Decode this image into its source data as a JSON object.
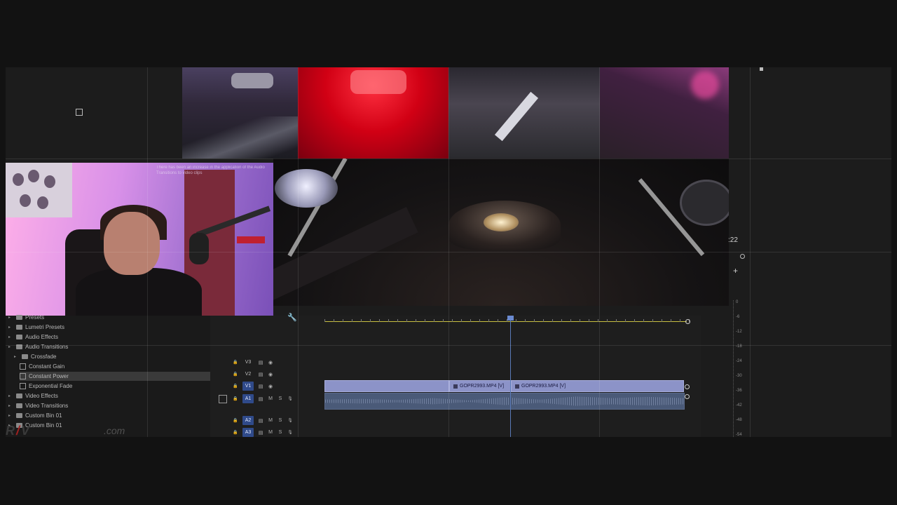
{
  "project_panel": {
    "items": [
      {
        "label": "Presets",
        "indent": 1,
        "type": "folder"
      },
      {
        "label": "Lumetri Presets",
        "indent": 1,
        "type": "folder"
      },
      {
        "label": "Audio Effects",
        "indent": 1,
        "type": "folder"
      },
      {
        "label": "Audio Transitions",
        "indent": 1,
        "type": "folder"
      },
      {
        "label": "Crossfade",
        "indent": 2,
        "type": "folder"
      },
      {
        "label": "Constant Gain",
        "indent": 3,
        "type": "effect"
      },
      {
        "label": "Constant Power",
        "indent": 3,
        "type": "effect",
        "selected": true
      },
      {
        "label": "Exponential Fade",
        "indent": 3,
        "type": "effect"
      },
      {
        "label": "Video Effects",
        "indent": 1,
        "type": "folder"
      },
      {
        "label": "Video Transitions",
        "indent": 1,
        "type": "folder"
      },
      {
        "label": "Custom Bin 01",
        "indent": 1,
        "type": "folder"
      },
      {
        "label": "Custom Bin 01",
        "indent": 1,
        "type": "folder"
      }
    ]
  },
  "watermark": {
    "suffix": ".com"
  },
  "webcam_overlay_text": "There has been an increase in the application of the Audio Transitions to video clips",
  "timeline": {
    "tracks": [
      {
        "name": "V3",
        "kind": "video",
        "active": false
      },
      {
        "name": "V2",
        "kind": "video",
        "active": false
      },
      {
        "name": "V1",
        "kind": "video",
        "active": true
      },
      {
        "name": "A1",
        "kind": "audio",
        "active": true
      },
      {
        "name": "A2",
        "kind": "audio",
        "active": true
      },
      {
        "name": "A3",
        "kind": "audio",
        "active": true
      }
    ],
    "clips": [
      {
        "label": "GOPR2993.MP4 [V]"
      },
      {
        "label": "GOPR2993.MP4 [V]"
      }
    ],
    "mute_label": "M",
    "solo_label": "S"
  },
  "program": {
    "timecode": ":22"
  },
  "meter": {
    "labels": [
      "0",
      "-6",
      "-12",
      "-18",
      "-24",
      "-30",
      "-36",
      "-42",
      "-48",
      "-54"
    ]
  },
  "colors": {
    "accent": "#2f4a8a",
    "clip_video": "#8c93c8",
    "clip_audio": "#4a5a78",
    "ruler": "#c8c040",
    "playhead": "#5a7ab8"
  }
}
